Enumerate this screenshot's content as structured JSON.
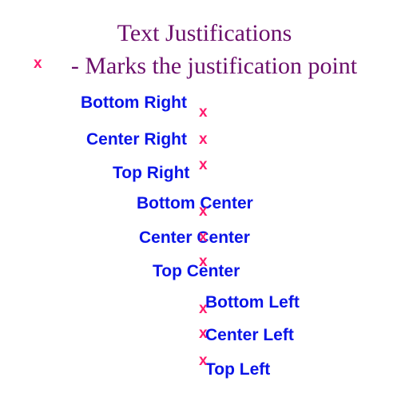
{
  "title": {
    "line1": "Text Justifications",
    "line2": "- Marks the justification point"
  },
  "mark_glyph": "x",
  "samples": [
    {
      "label": "Bottom Right"
    },
    {
      "label": "Center Right"
    },
    {
      "label": "Top Right"
    },
    {
      "label": "Bottom Center"
    },
    {
      "label": "Center Center"
    },
    {
      "label": "Top Center"
    },
    {
      "label": "Bottom Left"
    },
    {
      "label": "Center Left"
    },
    {
      "label": "Top Left"
    }
  ],
  "colors": {
    "title": "#6b0e6b",
    "sample_text": "#0a14e8",
    "mark": "#ff1a6e",
    "background": "#ffffff"
  }
}
